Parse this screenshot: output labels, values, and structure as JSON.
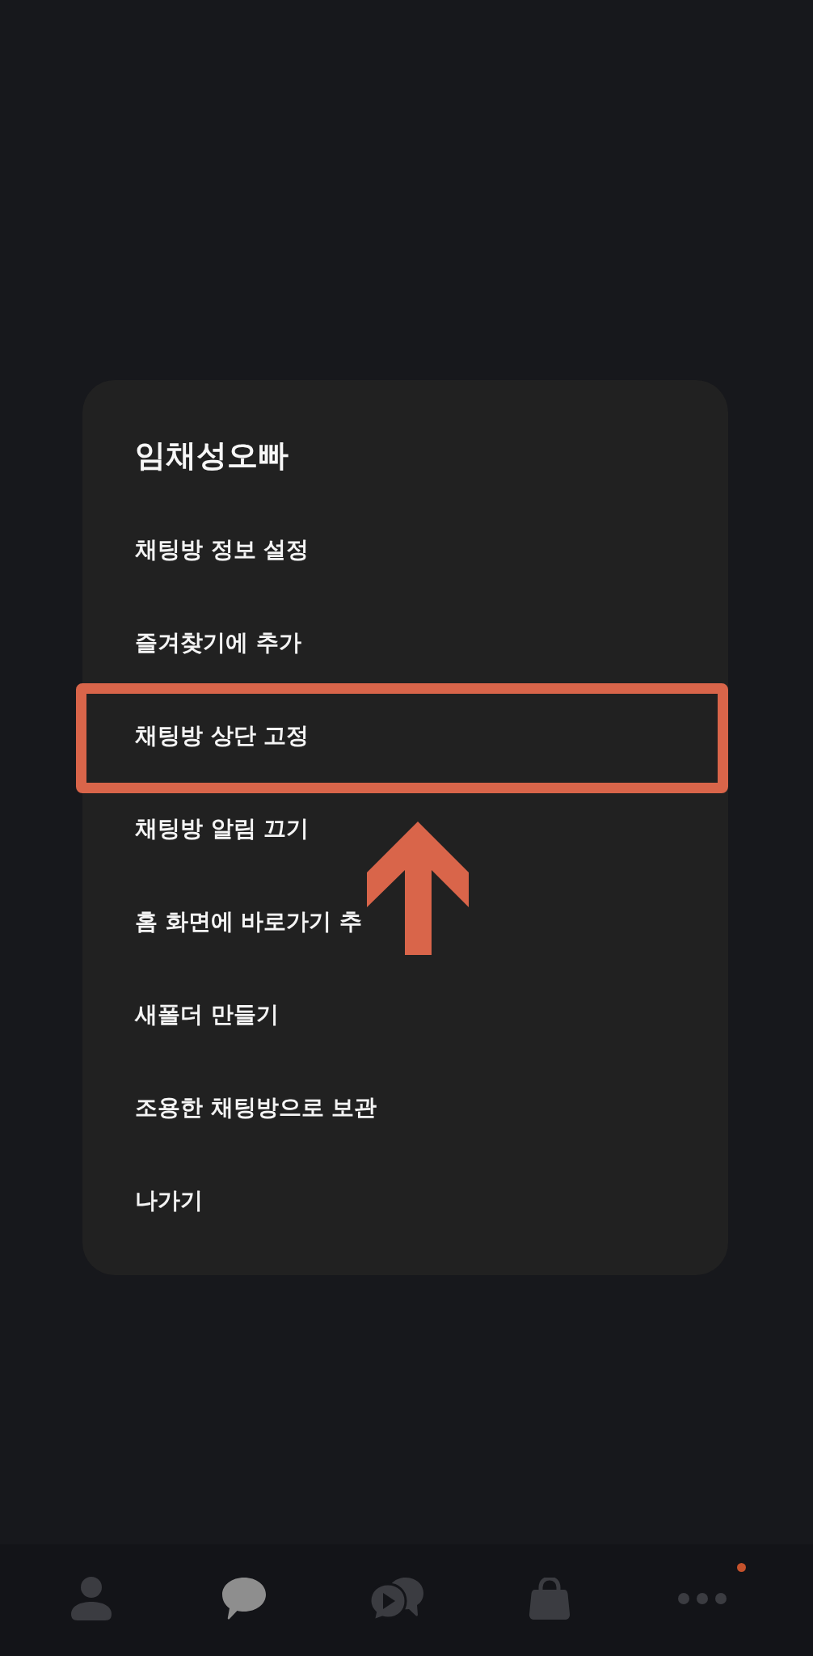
{
  "menu": {
    "title": "임채성오빠",
    "items": [
      {
        "label": "채팅방 정보 설정",
        "highlighted": false
      },
      {
        "label": "즐겨찾기에 추가",
        "highlighted": false
      },
      {
        "label": "채팅방 상단 고정",
        "highlighted": true
      },
      {
        "label": "채팅방 알림 끄기",
        "highlighted": false
      },
      {
        "label": "홈 화면에 바로가기 추",
        "highlighted": false
      },
      {
        "label": "새폴더 만들기",
        "highlighted": false
      },
      {
        "label": "조용한 채팅방으로 보관",
        "highlighted": false
      },
      {
        "label": "나가기",
        "highlighted": false
      }
    ]
  },
  "bottom_nav": [
    {
      "kind": "profile",
      "selected": false,
      "badge": false
    },
    {
      "kind": "chat",
      "selected": true,
      "badge": false
    },
    {
      "kind": "openchat",
      "selected": false,
      "badge": false
    },
    {
      "kind": "shop",
      "selected": false,
      "badge": false
    },
    {
      "kind": "more",
      "selected": false,
      "badge": true
    }
  ]
}
